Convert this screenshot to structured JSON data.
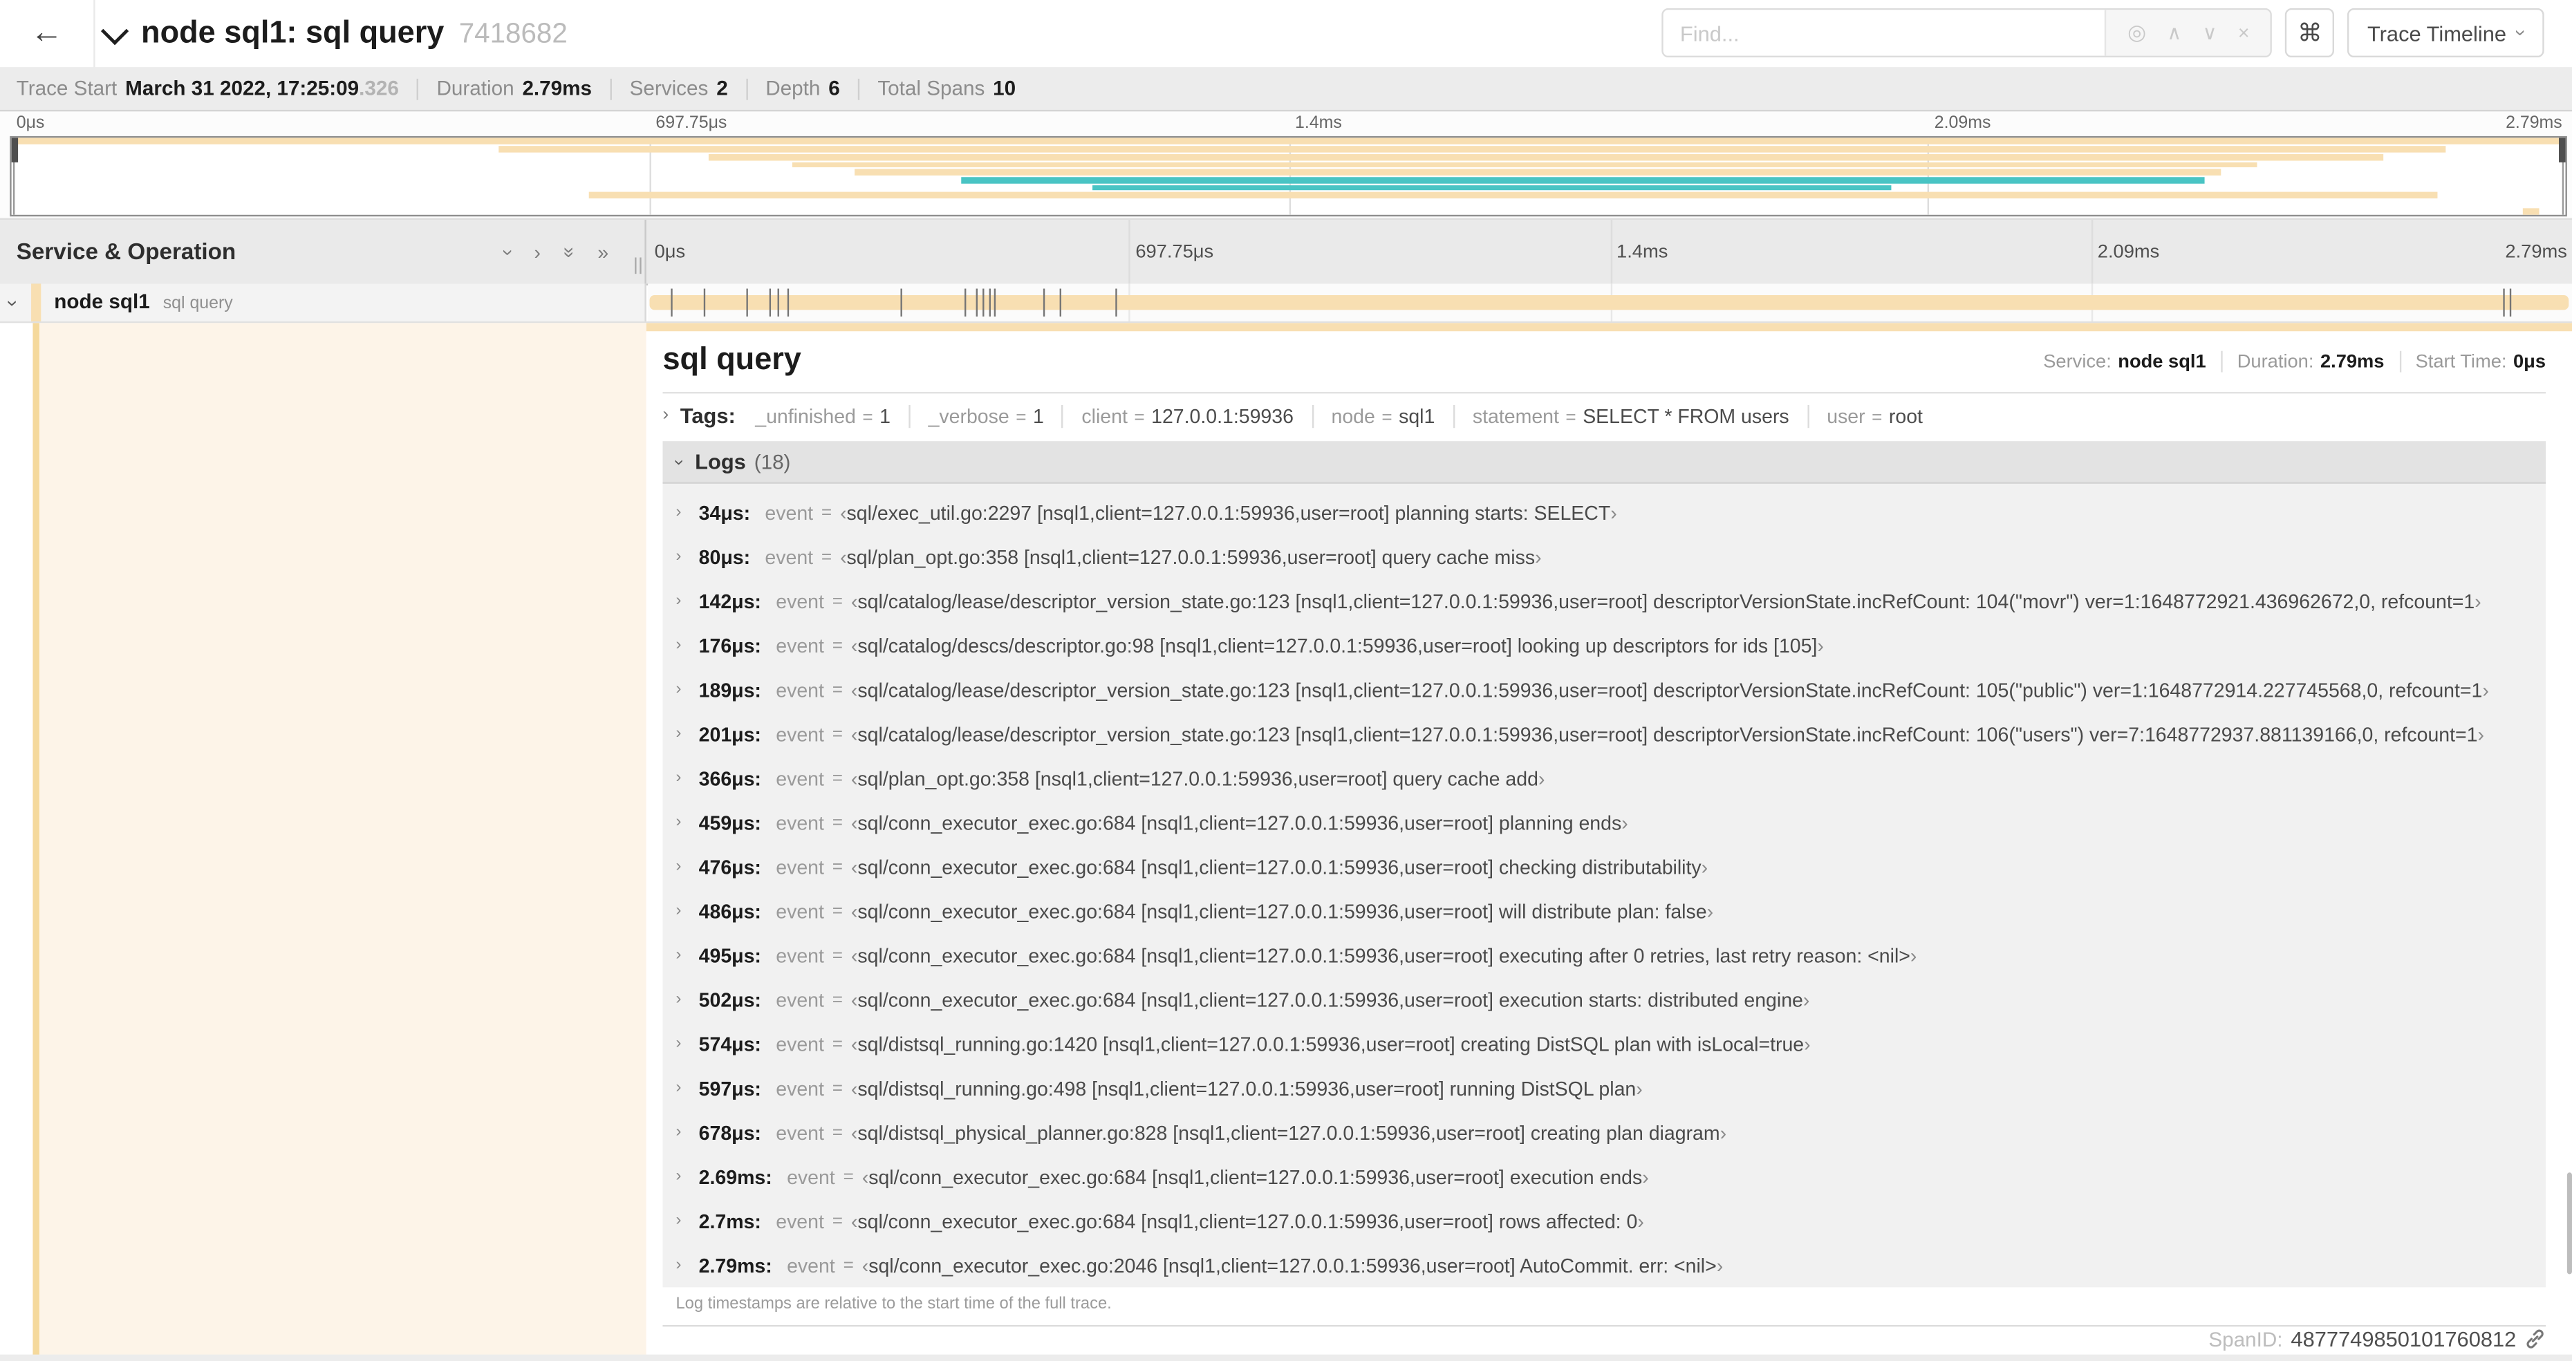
{
  "icons": {
    "back": "←",
    "chevron_right": "›",
    "double_right": "»",
    "target": "◎",
    "up": "∧",
    "down": "∨",
    "clear": "×",
    "command": "⌘",
    "link": "link-icon"
  },
  "colors": {
    "tan": "#F8DFB2",
    "teal": "#49C4C4",
    "stripe": "#F5D99C",
    "cream": "#FDF4E8"
  },
  "header": {
    "title": "node sql1: sql query",
    "trace_id": "7418682",
    "find_placeholder": "Find...",
    "view_label": "Trace Timeline"
  },
  "summary": {
    "items": [
      {
        "label": "Trace Start",
        "value": "March 31 2022, 17:25:09",
        "suffix": ".326"
      },
      {
        "label": "Duration",
        "value": "2.79ms"
      },
      {
        "label": "Services",
        "value": "2"
      },
      {
        "label": "Depth",
        "value": "6"
      },
      {
        "label": "Total Spans",
        "value": "10"
      }
    ]
  },
  "timeline": {
    "total_us": 2790,
    "ticks": [
      {
        "label": "0μs",
        "pos": 0
      },
      {
        "label": "697.75μs",
        "pos": 25
      },
      {
        "label": "1.4ms",
        "pos": 50
      },
      {
        "label": "2.09ms",
        "pos": 75
      },
      {
        "label": "2.79ms",
        "pos": 100
      }
    ],
    "gridlines": [
      25,
      50,
      75
    ]
  },
  "minimap": {
    "rows": [
      {
        "start": 0.2,
        "end": 99.8,
        "color": "tan"
      },
      {
        "start": 19.1,
        "end": 95.3,
        "color": "tan"
      },
      {
        "start": 27.3,
        "end": 92.9,
        "color": "tan"
      },
      {
        "start": 30.6,
        "end": 87.9,
        "color": "tan"
      },
      {
        "start": 33.0,
        "end": 86.5,
        "color": "tan"
      },
      {
        "start": 37.2,
        "end": 85.9,
        "color": "teal"
      },
      {
        "start": 42.3,
        "end": 73.6,
        "color": "teal"
      },
      {
        "start": 22.6,
        "end": 95.0,
        "color": "tan"
      },
      {
        "start": 0,
        "end": 0,
        "color": "tan"
      },
      {
        "start": 98.3,
        "end": 99.0,
        "color": "tan"
      }
    ]
  },
  "span_table": {
    "header": "Service & Operation",
    "row": {
      "service": "node sql1",
      "operation": "sql query"
    }
  },
  "detail": {
    "title": "sql query",
    "service_label": "Service:",
    "service_value": "node sql1",
    "duration_label": "Duration:",
    "duration_value": "2.79ms",
    "start_label": "Start Time:",
    "start_value": "0μs",
    "tags_label": "Tags:",
    "eq": "=",
    "time_colon": ":",
    "quote_open": "‹",
    "quote_close": "›",
    "log_key": "event",
    "tags": [
      {
        "key": "_unfinished",
        "value": "1"
      },
      {
        "key": "_verbose",
        "value": "1"
      },
      {
        "key": "client",
        "value": "127.0.0.1:59936"
      },
      {
        "key": "node",
        "value": "sql1"
      },
      {
        "key": "statement",
        "value": "SELECT * FROM users"
      },
      {
        "key": "user",
        "value": "root"
      }
    ],
    "logs_label": "Logs",
    "logs_count": "(18)",
    "logs": [
      {
        "t": "34μs",
        "us": 34,
        "v": "sql/exec_util.go:2297 [nsql1,client=127.0.0.1:59936,user=root] planning starts: SELECT"
      },
      {
        "t": "80μs",
        "us": 80,
        "v": "sql/plan_opt.go:358 [nsql1,client=127.0.0.1:59936,user=root] query cache miss"
      },
      {
        "t": "142μs",
        "us": 142,
        "v": "sql/catalog/lease/descriptor_version_state.go:123 [nsql1,client=127.0.0.1:59936,user=root] descriptorVersionState.incRefCount: 104(\"movr\") ver=1:1648772921.436962672,0, refcount=1"
      },
      {
        "t": "176μs",
        "us": 176,
        "v": "sql/catalog/descs/descriptor.go:98 [nsql1,client=127.0.0.1:59936,user=root] looking up descriptors for ids [105]"
      },
      {
        "t": "189μs",
        "us": 189,
        "v": "sql/catalog/lease/descriptor_version_state.go:123 [nsql1,client=127.0.0.1:59936,user=root] descriptorVersionState.incRefCount: 105(\"public\") ver=1:1648772914.227745568,0, refcount=1"
      },
      {
        "t": "201μs",
        "us": 201,
        "v": "sql/catalog/lease/descriptor_version_state.go:123 [nsql1,client=127.0.0.1:59936,user=root] descriptorVersionState.incRefCount: 106(\"users\") ver=7:1648772937.881139166,0, refcount=1"
      },
      {
        "t": "366μs",
        "us": 366,
        "v": "sql/plan_opt.go:358 [nsql1,client=127.0.0.1:59936,user=root] query cache add"
      },
      {
        "t": "459μs",
        "us": 459,
        "v": "sql/conn_executor_exec.go:684 [nsql1,client=127.0.0.1:59936,user=root] planning ends"
      },
      {
        "t": "476μs",
        "us": 476,
        "v": "sql/conn_executor_exec.go:684 [nsql1,client=127.0.0.1:59936,user=root] checking distributability"
      },
      {
        "t": "486μs",
        "us": 486,
        "v": "sql/conn_executor_exec.go:684 [nsql1,client=127.0.0.1:59936,user=root] will distribute plan: false"
      },
      {
        "t": "495μs",
        "us": 495,
        "v": "sql/conn_executor_exec.go:684 [nsql1,client=127.0.0.1:59936,user=root] executing after 0 retries, last retry reason: <nil>"
      },
      {
        "t": "502μs",
        "us": 502,
        "v": "sql/conn_executor_exec.go:684 [nsql1,client=127.0.0.1:59936,user=root] execution starts: distributed engine"
      },
      {
        "t": "574μs",
        "us": 574,
        "v": "sql/distsql_running.go:1420 [nsql1,client=127.0.0.1:59936,user=root] creating DistSQL plan with isLocal=true"
      },
      {
        "t": "597μs",
        "us": 597,
        "v": "sql/distsql_running.go:498 [nsql1,client=127.0.0.1:59936,user=root] running DistSQL plan"
      },
      {
        "t": "678μs",
        "us": 678,
        "v": "sql/distsql_physical_planner.go:828 [nsql1,client=127.0.0.1:59936,user=root] creating plan diagram"
      },
      {
        "t": "2.69ms",
        "us": 2690,
        "v": "sql/conn_executor_exec.go:684 [nsql1,client=127.0.0.1:59936,user=root] execution ends"
      },
      {
        "t": "2.7ms",
        "us": 2700,
        "v": "sql/conn_executor_exec.go:684 [nsql1,client=127.0.0.1:59936,user=root] rows affected: 0"
      },
      {
        "t": "2.79ms",
        "us": 2790,
        "v": "sql/conn_executor_exec.go:2046 [nsql1,client=127.0.0.1:59936,user=root] AutoCommit. err: <nil>"
      }
    ],
    "logs_note": "Log timestamps are relative to the start time of the full trace.",
    "span_id_label": "SpanID:",
    "span_id": "4877749850101760812"
  }
}
